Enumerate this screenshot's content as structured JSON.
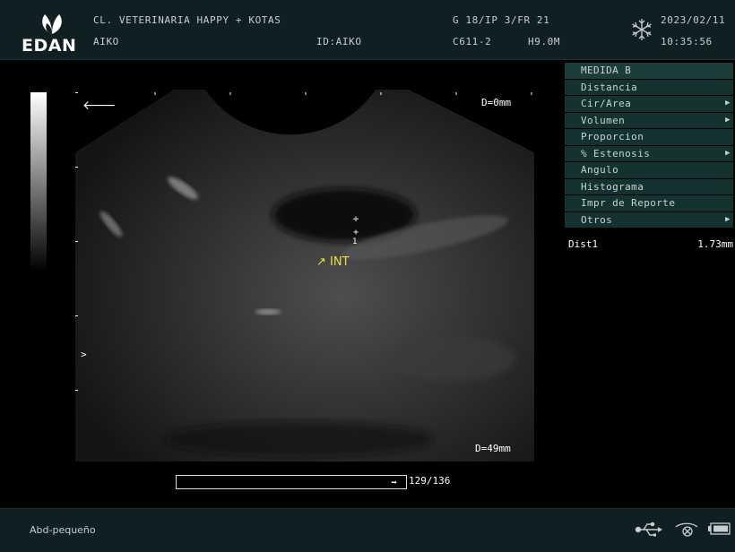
{
  "header": {
    "brand": "EDAN",
    "clinic": "CL. VETERINARIA HAPPY + KOTAS",
    "patient": "AIKO",
    "patient_id": "ID:AIKO",
    "params_top": "G 18/IP 3/FR 21",
    "probe": "C611-2",
    "freq": "H9.0M",
    "date": "2023/02/11",
    "time": "10:35:56",
    "freeze_icon": "snowflake-icon"
  },
  "image": {
    "depth_top": "D=0mm",
    "depth_bottom": "D=49mm",
    "annotation": "INT",
    "caliper_label": "1",
    "left_arrow_glyph": "🡐",
    "focus_marker": ">"
  },
  "cine": {
    "counter": "129/136"
  },
  "menu": {
    "title": "MEDIDA B",
    "items": [
      {
        "label": "Distancia",
        "submenu": false
      },
      {
        "label": "Cir/Area",
        "submenu": true
      },
      {
        "label": "Volumen",
        "submenu": true
      },
      {
        "label": "Proporcion",
        "submenu": false
      },
      {
        "label": "% Estenosis",
        "submenu": true
      },
      {
        "label": "Angulo",
        "submenu": false
      },
      {
        "label": "Histograma",
        "submenu": false
      },
      {
        "label": "Impr de Reporte",
        "submenu": false
      },
      {
        "label": "Otros",
        "submenu": true
      }
    ]
  },
  "measurements": [
    {
      "name": "Dist1",
      "value": "1.73mm"
    }
  ],
  "footer": {
    "preset": "Abd-pequeño",
    "icons": [
      "usb-icon",
      "network-icon",
      "battery-icon"
    ]
  },
  "colors": {
    "bar": "#0f1f22",
    "menu_item": "#14322f",
    "annotation": "#e7e13a"
  }
}
